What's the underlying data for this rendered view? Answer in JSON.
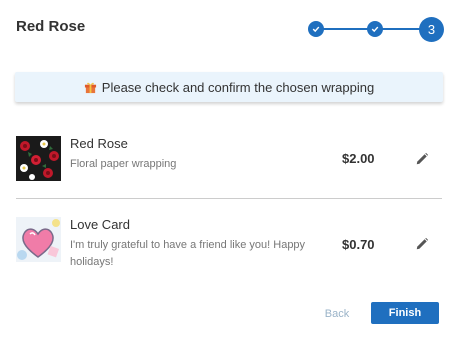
{
  "header": {
    "title": "Red Rose"
  },
  "stepper": {
    "current_step": "3",
    "accent_color": "#1f6fbf"
  },
  "banner": {
    "icon": "gift-icon",
    "text": "Please check and confirm the chosen wrapping"
  },
  "items": [
    {
      "name": "Red Rose",
      "description": "Floral paper wrapping",
      "price": "$2.00",
      "thumb": "floral-thumbnail",
      "edit_icon": "pencil-icon"
    },
    {
      "name": "Love Card",
      "description": "I'm truly grateful to have a friend like you! Happy holidays!",
      "price": "$0.70",
      "thumb": "heart-card-thumbnail",
      "edit_icon": "pencil-icon"
    }
  ],
  "footer": {
    "back_label": "Back",
    "finish_label": "Finish"
  }
}
